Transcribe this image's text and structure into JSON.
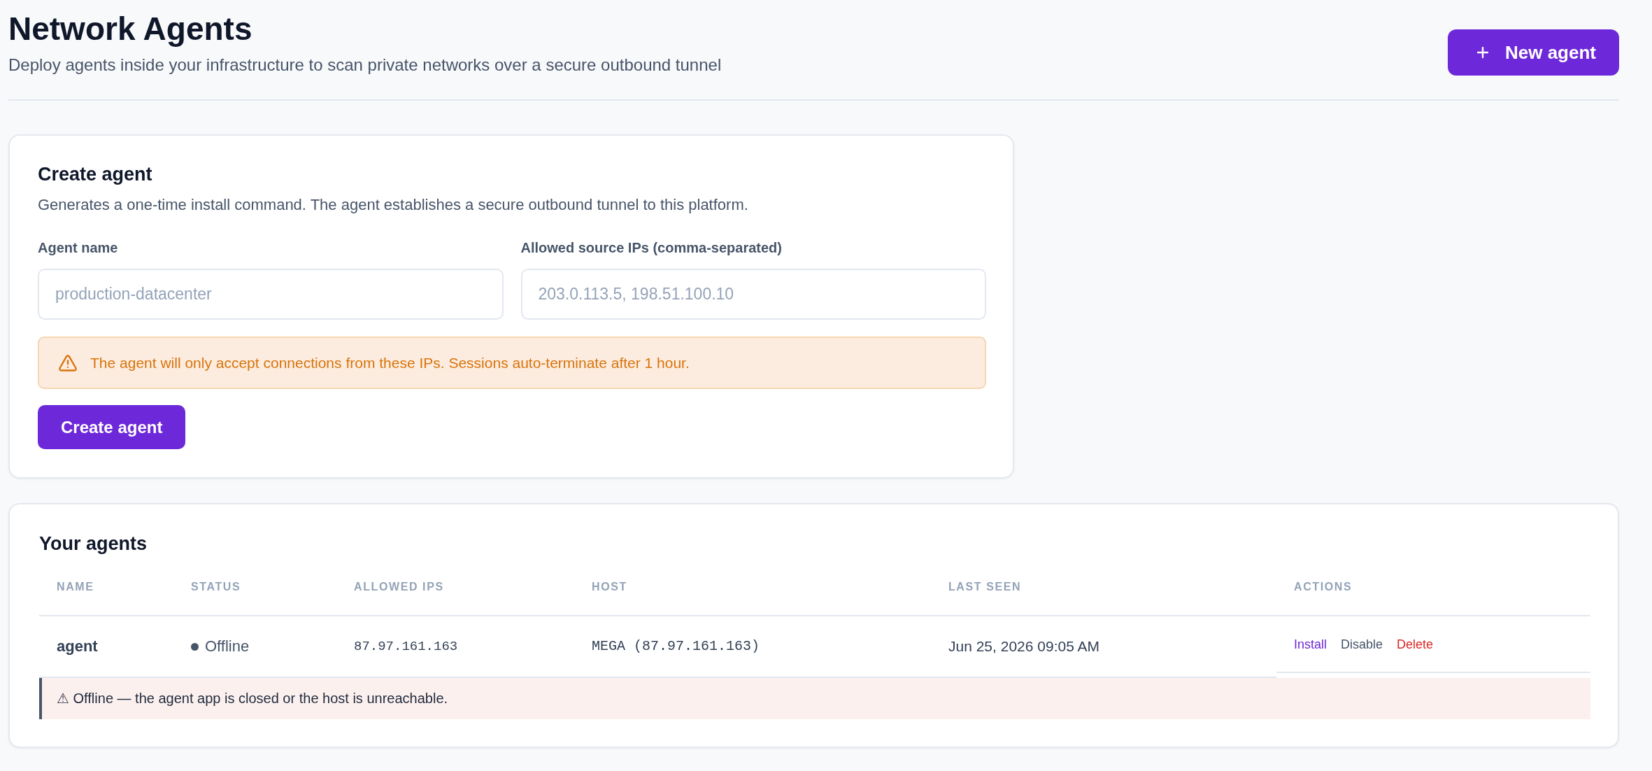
{
  "header": {
    "title": "Network Agents",
    "subtitle": "Deploy agents inside your infrastructure to scan private networks over a secure outbound tunnel",
    "new_button": "New agent"
  },
  "create_card": {
    "title": "Create agent",
    "description": "Generates a one-time install command. The agent establishes a secure outbound tunnel to this platform.",
    "fields": [
      {
        "label": "Agent name",
        "placeholder": "production-datacenter"
      },
      {
        "label": "Allowed source IPs (comma-separated)",
        "placeholder": "203.0.113.5, 198.51.100.10"
      }
    ],
    "notice": "The agent will only accept connections from these IPs. Sessions auto-terminate after 1 hour.",
    "submit": "Create agent"
  },
  "agents_table": {
    "title": "Your agents",
    "columns": [
      "NAME",
      "STATUS",
      "ALLOWED IPS",
      "HOST",
      "LAST SEEN",
      "ACTIONS"
    ],
    "rows": [
      {
        "name": "agent",
        "status": {
          "label": "Offline",
          "color": "#475569"
        },
        "allowed_ips": "87.97.161.163",
        "host": "MEGA (87.97.161.163)",
        "last_seen": "Jun 25, 2026 09:05 AM",
        "actions": [
          {
            "label": "Install",
            "kind": "primary"
          },
          {
            "label": "Disable",
            "kind": "neutral"
          },
          {
            "label": "Delete",
            "kind": "danger"
          }
        ],
        "alert": "⚠ Offline — the agent app is closed or the host is unreachable."
      }
    ]
  }
}
